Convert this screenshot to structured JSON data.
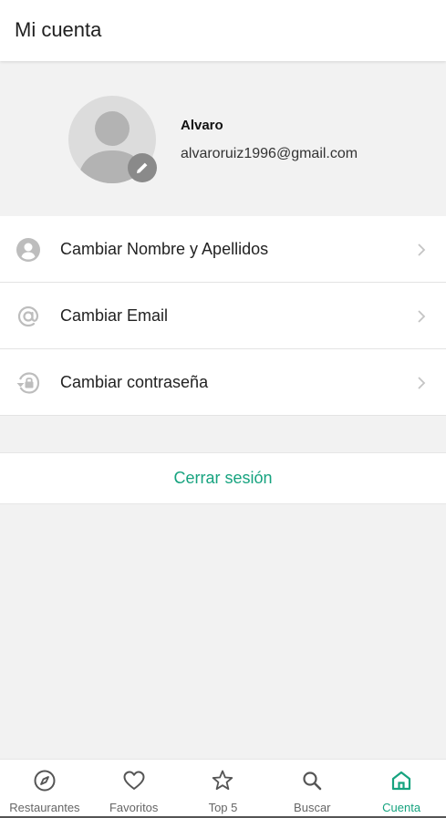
{
  "header": {
    "title": "Mi cuenta"
  },
  "profile": {
    "name": "Alvaro",
    "email": "alvaroruiz1996@gmail.com"
  },
  "menu": {
    "items": [
      {
        "label": "Cambiar Nombre y Apellidos",
        "icon": "user-circle-icon"
      },
      {
        "label": "Cambiar Email",
        "icon": "at-sign-icon"
      },
      {
        "label": "Cambiar contraseña",
        "icon": "lock-reset-icon"
      }
    ]
  },
  "logout": {
    "label": "Cerrar sesión"
  },
  "tabbar": {
    "tabs": [
      {
        "label": "Restaurantes",
        "icon": "compass-icon"
      },
      {
        "label": "Favoritos",
        "icon": "heart-icon"
      },
      {
        "label": "Top 5",
        "icon": "star-icon"
      },
      {
        "label": "Buscar",
        "icon": "search-icon"
      },
      {
        "label": "Cuenta",
        "icon": "home-icon",
        "active": true
      }
    ]
  },
  "colors": {
    "accent": "#16a37f",
    "background": "#f2f2f2",
    "icon_gray": "#bdbdbd"
  }
}
